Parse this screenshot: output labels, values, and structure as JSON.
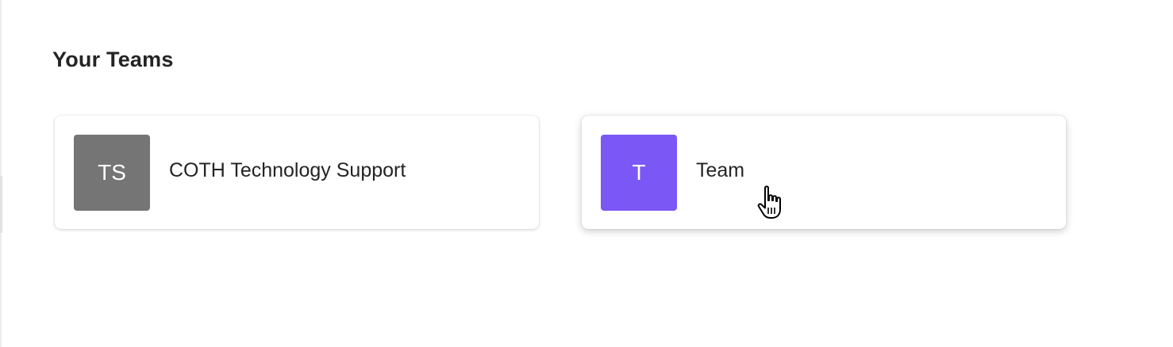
{
  "section": {
    "title": "Your Teams"
  },
  "teams": [
    {
      "initials": "TS",
      "name": "COTH Technology Support",
      "avatar_color": "#757575"
    },
    {
      "initials": "T",
      "name": "Team",
      "avatar_color": "#7B57F6"
    }
  ],
  "cursor": {
    "icon": "hand-pointer-icon"
  }
}
